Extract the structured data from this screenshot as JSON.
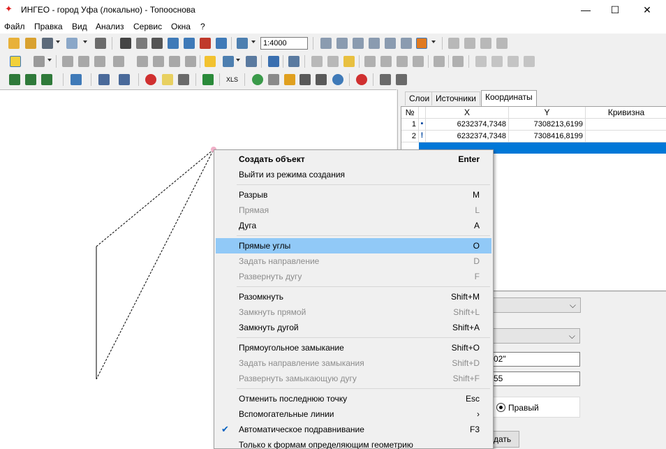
{
  "window": {
    "title": "ИНГЕО - город Уфа (локально) - Топооснова",
    "minimize": "—",
    "maximize": "☐",
    "close": "✕"
  },
  "menu": [
    "Файл",
    "Правка",
    "Вид",
    "Анализ",
    "Сервис",
    "Окна",
    "?"
  ],
  "toolbar": {
    "scale": "1:4000",
    "xls_label": "XLS"
  },
  "panel": {
    "tabs": [
      "Слои",
      "Источники",
      "Координаты"
    ],
    "active_tab": "Координаты",
    "columns": [
      "№",
      "X",
      "Y",
      "Кривизна"
    ],
    "rows": [
      {
        "n": "1",
        "marker": "▪",
        "x": "6232374,7348",
        "y": "7308213,6199",
        "curv": ""
      },
      {
        "n": "2",
        "marker": "!",
        "x": "6232374,7348",
        "y": "7308416,8199",
        "curv": ""
      }
    ],
    "field1": "02\"",
    "field2": "55",
    "radio_right": "Правый",
    "button": "дать"
  },
  "context_menu": [
    {
      "label": "Создать объект",
      "key": "Enter",
      "bold": true
    },
    {
      "label": "Выйти из режима создания",
      "key": ""
    },
    {
      "sep": true
    },
    {
      "label": "Разрыв",
      "key": "M"
    },
    {
      "label": "Прямая",
      "key": "L",
      "disabled": true
    },
    {
      "label": "Дуга",
      "key": "A"
    },
    {
      "sep": true
    },
    {
      "label": "Прямые углы",
      "key": "O",
      "highlighted": true
    },
    {
      "label": "Задать направление",
      "key": "D",
      "disabled": true
    },
    {
      "label": "Развернуть дугу",
      "key": "F",
      "disabled": true
    },
    {
      "sep": true
    },
    {
      "label": "Разомкнуть",
      "key": "Shift+M"
    },
    {
      "label": "Замкнуть прямой",
      "key": "Shift+L",
      "disabled": true
    },
    {
      "label": "Замкнуть дугой",
      "key": "Shift+A"
    },
    {
      "sep": true
    },
    {
      "label": "Прямоугольное замыкание",
      "key": "Shift+O"
    },
    {
      "label": "Задать направление замыкания",
      "key": "Shift+D",
      "disabled": true
    },
    {
      "label": "Развернуть замыкающую дугу",
      "key": "Shift+F",
      "disabled": true
    },
    {
      "sep": true
    },
    {
      "label": "Отменить последнюю точку",
      "key": "Esc"
    },
    {
      "label": "Вспомогательные линии",
      "key": "",
      "submenu": true
    },
    {
      "label": "Автоматическое подравнивание",
      "key": "F3",
      "checked": true
    },
    {
      "label": "Только к формам определяющим геометрию",
      "key": ""
    }
  ],
  "colors": {
    "selection": "#0078d7",
    "menu_highlight": "#91c9f7",
    "accent_red": "#e02020"
  }
}
